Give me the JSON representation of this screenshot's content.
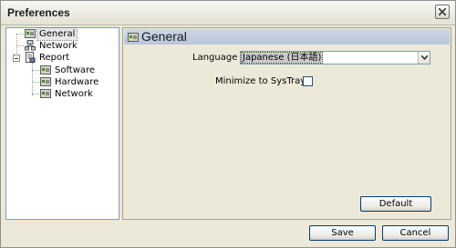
{
  "window": {
    "title": "Preferences"
  },
  "tree": {
    "items": [
      {
        "label": "General",
        "selected": true
      },
      {
        "label": "Network"
      },
      {
        "label": "Report",
        "expanded": true
      },
      {
        "label": "Software"
      },
      {
        "label": "Hardware"
      },
      {
        "label": "Network"
      }
    ]
  },
  "panel": {
    "title": "General",
    "language_label": "Language",
    "language_value": "Japanese (日本語)",
    "minimize_label": "Minimize to SysTray",
    "minimize_checked": false,
    "default_button": "Default"
  },
  "footer": {
    "save_button": "Save",
    "cancel_button": "Cancel"
  },
  "colors": {
    "header_bg": "#c1cfe0",
    "button_border": "#003c74",
    "tree_border": "#7f9db9"
  }
}
